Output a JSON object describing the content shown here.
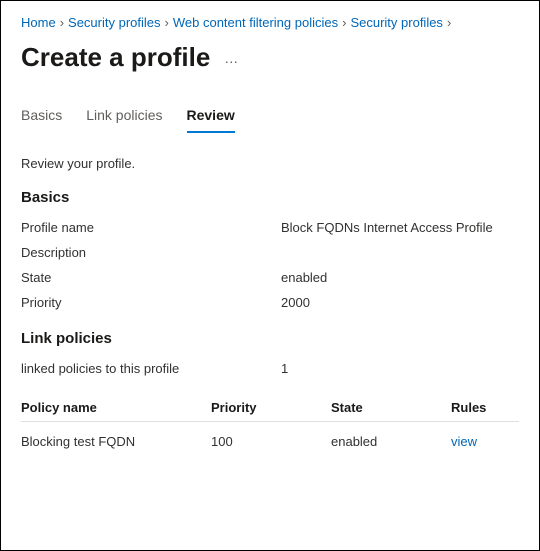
{
  "breadcrumb": {
    "items": [
      {
        "label": "Home"
      },
      {
        "label": "Security profiles"
      },
      {
        "label": "Web content filtering policies"
      },
      {
        "label": "Security profiles"
      }
    ],
    "separator": "›"
  },
  "header": {
    "title": "Create a profile",
    "more_label": "…"
  },
  "tabs": [
    {
      "label": "Basics",
      "active": false
    },
    {
      "label": "Link policies",
      "active": false
    },
    {
      "label": "Review",
      "active": true
    }
  ],
  "intro": "Review your profile.",
  "sections": {
    "basics": {
      "heading": "Basics",
      "rows": [
        {
          "k": "Profile name",
          "v": "Block FQDNs Internet Access Profile"
        },
        {
          "k": "Description",
          "v": ""
        },
        {
          "k": "State",
          "v": "enabled"
        },
        {
          "k": "Priority",
          "v": "2000"
        }
      ]
    },
    "link_policies": {
      "heading": "Link policies",
      "summary_k": "linked policies to this profile",
      "summary_v": "1",
      "table": {
        "headers": {
          "name": "Policy name",
          "priority": "Priority",
          "state": "State",
          "rules": "Rules"
        },
        "rows": [
          {
            "name": "Blocking test FQDN",
            "priority": "100",
            "state": "enabled",
            "rules": "view"
          }
        ]
      }
    }
  }
}
